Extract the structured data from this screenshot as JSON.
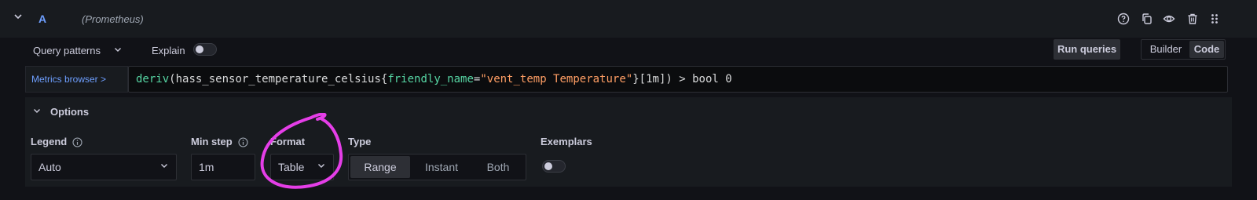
{
  "header": {
    "query_letter": "A",
    "datasource": "(Prometheus)",
    "icons": [
      "help-icon",
      "copy-icon",
      "eye-icon",
      "trash-icon",
      "drag-handle-icon"
    ]
  },
  "toolbar": {
    "query_patterns_label": "Query patterns",
    "explain_label": "Explain",
    "explain_enabled": false,
    "run_queries_label": "Run queries",
    "mode_builder_label": "Builder",
    "mode_code_label": "Code",
    "active_mode": "Code"
  },
  "editor": {
    "metrics_browser_label": "Metrics browser >",
    "query": {
      "fn": "deriv",
      "open": "(",
      "metric": "hass_sensor_temperature_celsius",
      "brace_open": "{",
      "label_key": "friendly_name",
      "eq": "=",
      "label_value": "\"vent_temp Temperature\"",
      "brace_close": "}",
      "rest": "[1m]) > bool 0"
    }
  },
  "options": {
    "title": "Options",
    "legend_label": "Legend",
    "legend_value": "Auto",
    "min_step_label": "Min step",
    "min_step_value": "1m",
    "format_label": "Format",
    "format_value": "Table",
    "type_label": "Type",
    "type_options": [
      "Range",
      "Instant",
      "Both"
    ],
    "type_selected": "Range",
    "exemplars_label": "Exemplars",
    "exemplars_enabled": false
  },
  "annotation": {
    "color": "#e53ee8",
    "target": "Format"
  }
}
